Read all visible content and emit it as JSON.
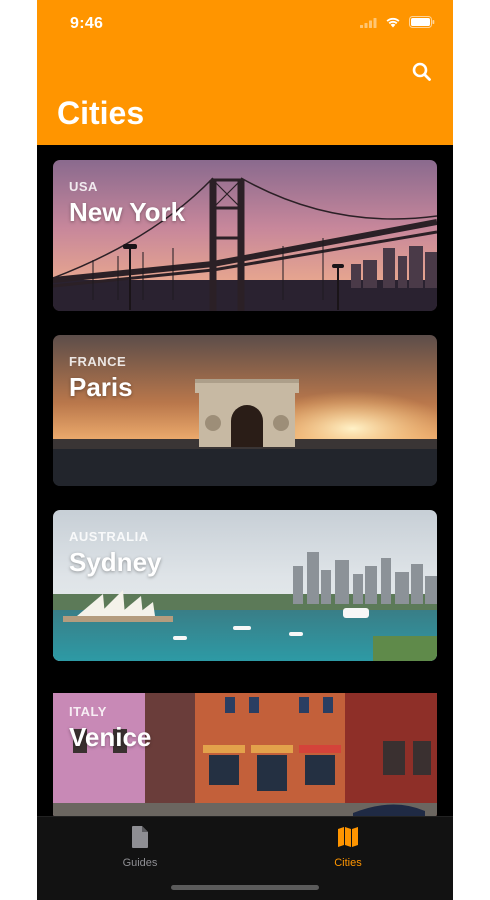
{
  "status_bar": {
    "time": "9:46"
  },
  "header": {
    "title": "Cities",
    "search_icon": "search-icon"
  },
  "cards": [
    {
      "country": "USA",
      "city": "New York"
    },
    {
      "country": "FRANCE",
      "city": "Paris"
    },
    {
      "country": "AUSTRALIA",
      "city": "Sydney"
    },
    {
      "country": "ITALY",
      "city": "Venice"
    }
  ],
  "tabbar": {
    "tabs": [
      {
        "label": "Guides",
        "icon": "document-icon",
        "selected": false
      },
      {
        "label": "Cities",
        "icon": "map-icon",
        "selected": true
      }
    ]
  },
  "colors": {
    "accent": "#ff9500",
    "inactive": "#8e8e93",
    "background": "#000000"
  }
}
